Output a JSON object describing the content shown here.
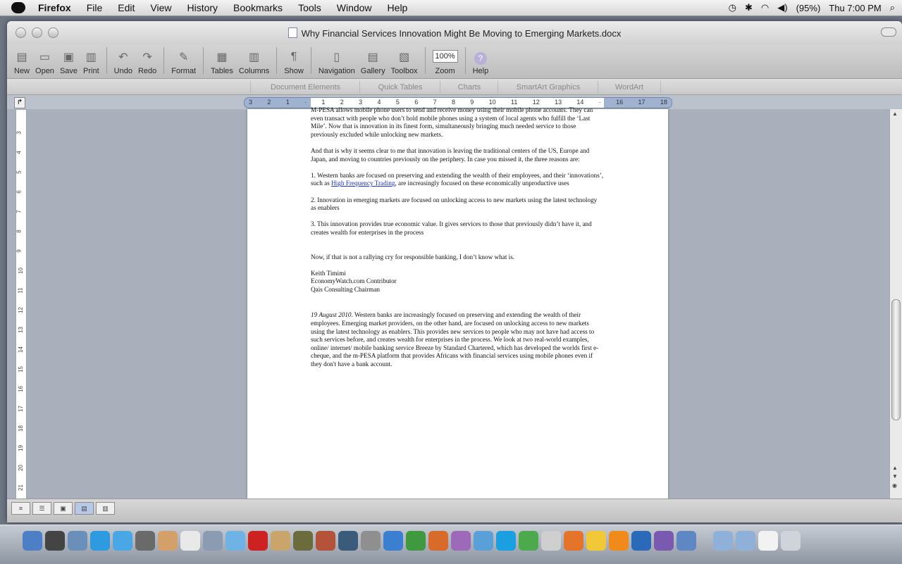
{
  "menubar": {
    "app": "Firefox",
    "items": [
      "File",
      "Edit",
      "View",
      "History",
      "Bookmarks",
      "Tools",
      "Window",
      "Help"
    ],
    "battery": "(95%)",
    "clock": "Thu 7:00 PM"
  },
  "window": {
    "title": "Why Financial Services Innovation Might Be Moving to Emerging Markets.docx"
  },
  "toolbar": {
    "new": "New",
    "open": "Open",
    "save": "Save",
    "print": "Print",
    "undo": "Undo",
    "redo": "Redo",
    "format": "Format",
    "tables": "Tables",
    "columns": "Columns",
    "show": "Show",
    "navigation": "Navigation",
    "gallery": "Gallery",
    "toolbox": "Toolbox",
    "zoom_value": "100%",
    "zoom": "Zoom",
    "help": "Help"
  },
  "ribbon": {
    "tabs": [
      "Document Elements",
      "Quick Tables",
      "Charts",
      "SmartArt Graphics",
      "WordArt"
    ]
  },
  "ruler": {
    "labels": [
      "3",
      "2",
      "1",
      "",
      "1",
      "2",
      "3",
      "4",
      "5",
      "6",
      "7",
      "8",
      "9",
      "10",
      "11",
      "12",
      "13",
      "14",
      "",
      "16",
      "17",
      "18"
    ]
  },
  "vruler": {
    "labels": [
      "3",
      "4",
      "5",
      "6",
      "7",
      "8",
      "9",
      "10",
      "11",
      "12",
      "13",
      "14",
      "15",
      "16",
      "17",
      "18",
      "19",
      "20",
      "21"
    ]
  },
  "document": {
    "p0": "M-PESA allows mobile phone users to send and receive money using their mobile phone accounts. They can even transact with people who don’t hold mobile phones using a system of local agents who fulfill the ‘Last Mile’. Now that is innovation in its finest form, simultaneously bringing much needed service to those previously excluded while unlocking new markets.",
    "p1": "And that is why it seems clear to me that innovation is leaving the traditional centers of the US, Europe and Japan, and moving to countries previously on the periphery. In case you missed it, the three reasons are:",
    "l1_pre": "1.     Western banks are focused on preserving and extending the wealth of their employees, and their ‘innovations’, such as ",
    "l1_link": "High Frequency Trading",
    "l1_post": ", are increasingly focused on these economically unproductive uses",
    "l2": "2.     Innovation in emerging markets are focused on unlocking access to new markets using the latest technology as enablers",
    "l3": "3.     This innovation provides true economic value. It gives services to those that previously didn’t have it, and creates wealth for enterprises in the process",
    "p2": "Now, if that is not a rallying cry for responsible banking, I don’t know what is.",
    "sig1": "Keith Timimi",
    "sig2": "EconomyWatch.com Contributor",
    "sig3": "Qais Consulting Chairman",
    "date": "19 August 2010",
    "summary": ". Western banks are increasingly focused on preserving and extending the wealth of their employees. Emerging market providers, on the other hand, are focused on unlocking access to new markets using the latest technology as enablers. This provides new services to people who may not have had access to such services before, and creates wealth for enterprises in the process. We look at two real-world examples, online/ internet/ mobile banking service Breeze by Standard Chartered, which has developed the worlds first e-cheque, and the m-PESA platform that provides Africans with financial services using mobile phones even if they don't have a bank account."
  }
}
